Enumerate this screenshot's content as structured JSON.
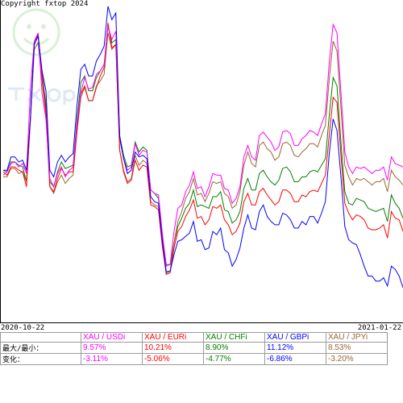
{
  "copyright": "Copyright fxtop 2024",
  "date_start": "2020-10-22",
  "date_end": "2021-01-22",
  "row_labels": {
    "max": "最大/最小：",
    "var": "变化："
  },
  "chart_data": {
    "type": "line",
    "title": "",
    "xlabel": "",
    "ylabel": "",
    "x_range": [
      "2020-10-22",
      "2021-01-22"
    ],
    "ylim": [
      -8.5,
      10.5
    ],
    "grid": false,
    "legend_position": "bottom",
    "series": [
      {
        "name": "XAU / USDi",
        "color": "#ff00ff",
        "max": "9.57%",
        "var": "-3.11%",
        "values": [
          0.4,
          0.6,
          1.1,
          1.2,
          0.9,
          1.1,
          0.5,
          5.6,
          8.5,
          9.0,
          5.3,
          3.8,
          0.2,
          -0.3,
          0.5,
          0.9,
          0.3,
          0.7,
          0.9,
          3.4,
          5.4,
          6.3,
          5.6,
          5.7,
          6.5,
          6.7,
          7.1,
          9.4,
          8.6,
          9.1,
          2.6,
          1.4,
          0.7,
          0.9,
          2.3,
          1.6,
          1.9,
          1.8,
          -0.5,
          -0.7,
          -0.8,
          -3.1,
          -5.1,
          -5.0,
          -3.0,
          -1.6,
          -1.4,
          -0.6,
          -0.2,
          0.6,
          -0.4,
          -0.3,
          -0.9,
          -0.3,
          0.5,
          0.4,
          0.4,
          -0.4,
          -0.5,
          -1.3,
          -1.0,
          -0.3,
          1.5,
          2.2,
          1.5,
          1.3,
          2.8,
          3.0,
          2.7,
          2.4,
          1.9,
          2.1,
          3.0,
          3.1,
          2.9,
          2.2,
          2.2,
          2.6,
          2.8,
          3.1,
          3.0,
          2.8,
          3.5,
          4.1,
          7.2,
          9.5,
          9.0,
          5.4,
          1.8,
          0.9,
          0.5,
          0.9,
          0.8,
          0.9,
          0.7,
          0.5,
          0.7,
          0.7,
          0.9,
          0.1,
          1.5,
          1.1,
          1.0,
          0.9
        ]
      },
      {
        "name": "XAU / EURi",
        "color": "#ff0000",
        "max": "10.21%",
        "var": "-5.06%",
        "values": [
          0.6,
          0.4,
          0.9,
          0.9,
          0.7,
          0.6,
          -0.3,
          3.8,
          8.3,
          8.9,
          6.4,
          4.3,
          -0.3,
          -0.6,
          0.2,
          0.8,
          0.4,
          0.6,
          0.6,
          3.1,
          5.3,
          5.8,
          4.9,
          4.9,
          5.7,
          6.4,
          6.9,
          9.6,
          8.1,
          8.3,
          1.9,
          0.6,
          -0.1,
          0.1,
          1.3,
          0.7,
          1.0,
          0.9,
          -1.4,
          -1.5,
          -1.7,
          -3.9,
          -5.6,
          -5.5,
          -4.0,
          -3.0,
          -2.7,
          -2.1,
          -1.7,
          -1.1,
          -2.2,
          -2.1,
          -2.6,
          -2.3,
          -1.5,
          -1.6,
          -1.4,
          -2.3,
          -2.6,
          -3.2,
          -3.0,
          -2.5,
          -1.2,
          -0.7,
          -1.4,
          -1.4,
          -0.6,
          -0.4,
          -0.8,
          -1.1,
          -1.4,
          -1.2,
          -0.5,
          -0.5,
          -0.7,
          -1.2,
          -1.2,
          -0.8,
          -0.9,
          -0.6,
          -0.5,
          -0.6,
          -0.1,
          0.4,
          2.8,
          5.1,
          4.8,
          1.6,
          -1.3,
          -1.9,
          -2.3,
          -2.0,
          -2.1,
          -2.3,
          -2.8,
          -2.9,
          -2.9,
          -2.8,
          -2.6,
          -3.4,
          -1.8,
          -2.2,
          -2.3,
          -3.0
        ]
      },
      {
        "name": "XAU / CHFi",
        "color": "#008000",
        "max": "8.90%",
        "var": "-4.77%",
        "values": [
          0.7,
          0.6,
          1.2,
          1.2,
          1.0,
          0.9,
          0.0,
          3.8,
          8.5,
          8.9,
          6.5,
          4.7,
          0.0,
          -0.3,
          0.6,
          1.2,
          0.8,
          0.9,
          1.0,
          3.7,
          6.0,
          6.4,
          5.5,
          5.5,
          6.3,
          6.7,
          7.1,
          9.4,
          8.4,
          8.6,
          2.8,
          1.6,
          0.9,
          1.0,
          2.4,
          1.8,
          2.1,
          1.9,
          -0.5,
          -0.7,
          -1.0,
          -3.3,
          -5.0,
          -5.0,
          -3.7,
          -2.7,
          -2.2,
          -1.6,
          -1.3,
          -0.5,
          -1.5,
          -1.4,
          -1.5,
          -1.6,
          -0.9,
          -0.9,
          -0.6,
          -1.7,
          -1.8,
          -2.5,
          -2.3,
          -1.8,
          -0.4,
          0.2,
          -0.5,
          -0.5,
          0.5,
          0.7,
          0.3,
          0.0,
          -0.2,
          0.1,
          0.8,
          0.9,
          0.6,
          0.0,
          0.0,
          0.3,
          0.3,
          0.6,
          0.7,
          0.6,
          1.0,
          1.4,
          4.0,
          6.3,
          5.8,
          2.4,
          -0.6,
          -1.3,
          -1.4,
          -1.0,
          -1.1,
          -1.2,
          -1.6,
          -1.7,
          -1.8,
          -1.7,
          -1.6,
          -2.4,
          -0.8,
          -1.3,
          -1.6,
          -2.2
        ]
      },
      {
        "name": "XAU / GBPi",
        "color": "#0000ff",
        "max": "11.12%",
        "var": "-6.86%",
        "values": [
          0.7,
          0.7,
          1.5,
          1.5,
          1.2,
          1.3,
          0.7,
          3.8,
          8.3,
          8.8,
          6.7,
          5.5,
          0.7,
          0.3,
          1.2,
          1.6,
          1.2,
          1.5,
          1.7,
          4.6,
          6.8,
          7.1,
          6.4,
          6.4,
          7.3,
          7.7,
          8.2,
          10.6,
          9.8,
          10.2,
          2.7,
          1.4,
          0.5,
          0.7,
          1.8,
          1.5,
          1.6,
          1.4,
          -0.9,
          -1.2,
          -1.3,
          -3.6,
          -5.5,
          -5.4,
          -4.4,
          -3.6,
          -3.5,
          -3.3,
          -3.1,
          -2.4,
          -3.6,
          -3.5,
          -4.1,
          -4.0,
          -3.0,
          -3.2,
          -2.8,
          -4.1,
          -4.3,
          -5.1,
          -4.7,
          -4.0,
          -2.8,
          -2.0,
          -2.8,
          -2.9,
          -1.8,
          -1.4,
          -2.1,
          -2.4,
          -2.6,
          -2.6,
          -1.9,
          -2.0,
          -2.3,
          -2.8,
          -2.8,
          -2.4,
          -2.6,
          -2.1,
          -2.1,
          -2.5,
          -1.9,
          -1.2,
          1.7,
          3.8,
          3.1,
          0.3,
          -2.7,
          -3.5,
          -3.7,
          -3.8,
          -4.4,
          -5.1,
          -5.7,
          -5.7,
          -6.0,
          -6.0,
          -5.8,
          -6.3,
          -5.1,
          -5.3,
          -5.7,
          -6.4
        ]
      },
      {
        "name": "XAU / JPYi",
        "color": "#996633",
        "max": "8.53%",
        "var": "-3.20%",
        "values": [
          0.3,
          0.3,
          0.8,
          0.8,
          0.5,
          0.6,
          0.0,
          3.6,
          8.0,
          8.4,
          6.1,
          4.0,
          -0.3,
          -0.7,
          0.0,
          0.4,
          -0.1,
          0.2,
          0.4,
          3.0,
          5.1,
          5.7,
          4.9,
          4.9,
          5.8,
          6.1,
          6.5,
          9.0,
          8.0,
          8.3,
          1.9,
          0.7,
          0.0,
          0.2,
          1.6,
          1.0,
          1.3,
          1.1,
          -1.2,
          -1.4,
          -1.5,
          -3.7,
          -5.4,
          -5.4,
          -3.7,
          -2.4,
          -1.8,
          -1.0,
          -0.6,
          0.2,
          -0.8,
          -0.7,
          -1.2,
          -0.7,
          0.0,
          -0.1,
          0.0,
          -0.7,
          -0.9,
          -1.6,
          -1.4,
          -0.6,
          1.0,
          1.8,
          1.1,
          0.9,
          2.2,
          2.4,
          2.0,
          1.8,
          1.3,
          1.5,
          2.3,
          2.4,
          2.2,
          1.6,
          1.5,
          1.8,
          2.0,
          2.3,
          2.3,
          2.1,
          2.8,
          3.4,
          6.2,
          8.5,
          7.9,
          4.5,
          1.0,
          0.3,
          -0.2,
          0.2,
          0.1,
          0.2,
          0.0,
          -0.2,
          0.0,
          0.0,
          0.2,
          -0.6,
          0.7,
          0.3,
          0.1,
          -0.2
        ]
      }
    ]
  }
}
